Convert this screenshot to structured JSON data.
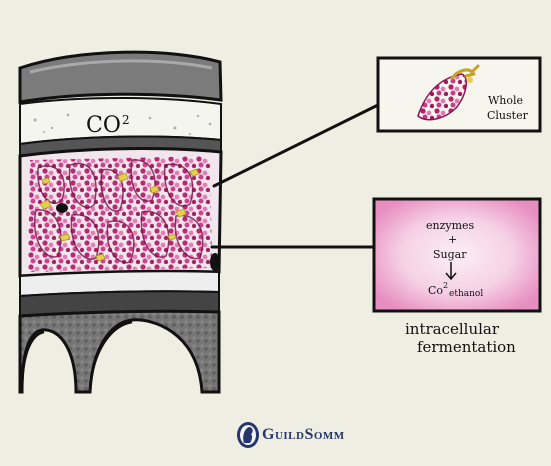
{
  "labels": {
    "co2_tank": "CO",
    "co2_tank_sup": "2",
    "whole_cluster_line1": "Whole",
    "whole_cluster_line2": "Cluster",
    "reaction_line1": "enzymes",
    "reaction_plus": "+",
    "reaction_line2": "Sugar",
    "reaction_co2": "Co",
    "reaction_co2_sup": "2",
    "reaction_ethanol": "ethanol",
    "caption_line1": "intracellular",
    "caption_line2": "fermentation"
  },
  "brand": {
    "name": "GuildSomm"
  },
  "colors": {
    "paper": "#efeee3",
    "grape_magenta": "#c0377f",
    "grape_pink": "#e58fbf",
    "stem_yellow": "#e6cf4e",
    "juice_pink": "#efb2d3",
    "tank_gray": "#707070",
    "ink": "#111111",
    "brand_navy": "#25366e"
  }
}
